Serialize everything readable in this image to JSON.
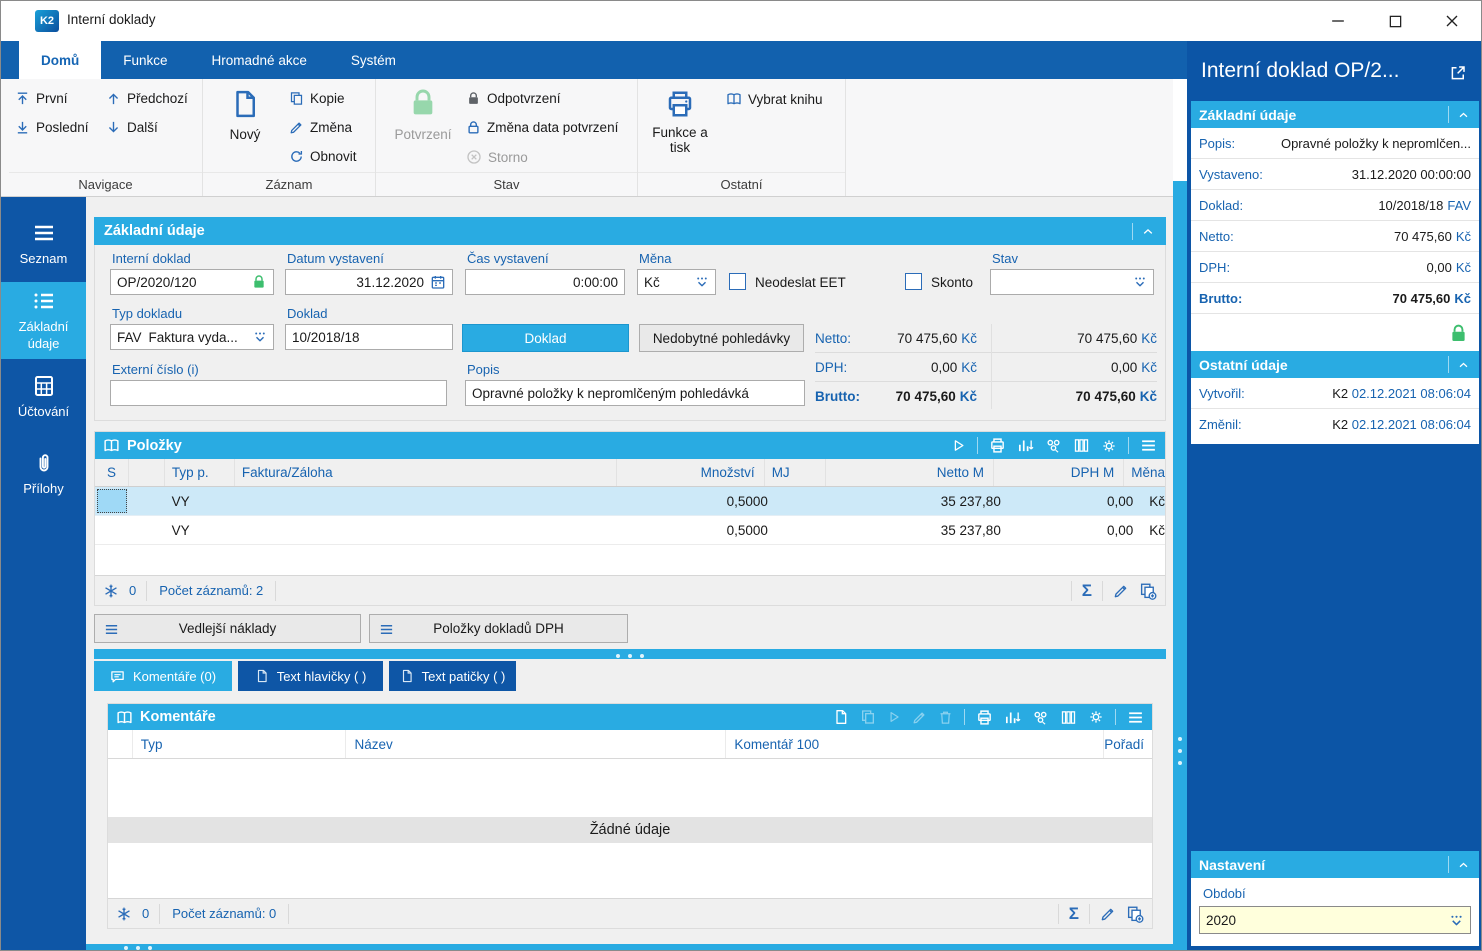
{
  "window": {
    "title": "Interní doklady"
  },
  "icons": {
    "sum_symbol": "Σ"
  },
  "ribbon": {
    "tabs": [
      {
        "label": "Domů"
      },
      {
        "label": "Funkce"
      },
      {
        "label": "Hromadné akce"
      },
      {
        "label": "Systém"
      }
    ],
    "navigace": {
      "label": "Navigace",
      "first": "První",
      "previous": "Předchozí",
      "last": "Poslední",
      "next": "Další"
    },
    "zaznam": {
      "label": "Záznam",
      "new": "Nový",
      "copy": "Kopie",
      "change": "Změna",
      "refresh": "Obnovit"
    },
    "stav": {
      "label": "Stav",
      "confirm": "Potvrzení",
      "unconfirm": "Odpotvrzení",
      "change_date": "Změna data potvrzení",
      "cancel": "Storno"
    },
    "ostatni": {
      "label": "Ostatní",
      "functions_print_line1": "Funkce a",
      "functions_print_line2": "tisk",
      "select_book": "Vybrat knihu"
    }
  },
  "sidebar": {
    "items": [
      {
        "label": "Seznam"
      },
      {
        "label": "Základní údaje"
      },
      {
        "label": "Účtování"
      },
      {
        "label": "Přílohy"
      }
    ]
  },
  "form": {
    "header": "Základní údaje",
    "interni_doklad": {
      "label": "Interní doklad",
      "value": "OP/2020/120"
    },
    "datum": {
      "label": "Datum vystavení",
      "value": "31.12.2020"
    },
    "cas": {
      "label": "Čas vystavení",
      "value": "0:00:00"
    },
    "mena": {
      "label": "Měna",
      "value": "Kč"
    },
    "neodeslat_eet": "Neodeslat EET",
    "skonto": "Skonto",
    "stav": {
      "label": "Stav",
      "value": ""
    },
    "typ_dokladu": {
      "label": "Typ dokladu",
      "code": "FAV",
      "value": "Faktura vyda..."
    },
    "doklad": {
      "label": "Doklad",
      "value": "10/2018/18"
    },
    "doklad_button": "Doklad",
    "nedobytne_button": "Nedobytné pohledávky",
    "externi": {
      "label": "Externí číslo (i)",
      "value": ""
    },
    "popis": {
      "label": "Popis",
      "value": "Opravné položky k nepromlčeným pohledávká"
    },
    "totals": {
      "netto": {
        "label": "Netto:",
        "value": "70 475,60",
        "unit": "Kč",
        "value2": "70 475,60",
        "unit2": "Kč"
      },
      "dph": {
        "label": "DPH:",
        "value": "0,00",
        "unit": "Kč",
        "value2": "0,00",
        "unit2": "Kč"
      },
      "brutto": {
        "label": "Brutto:",
        "value": "70 475,60",
        "unit": "Kč",
        "value2": "70 475,60",
        "unit2": "Kč"
      }
    }
  },
  "polozky": {
    "title": "Položky",
    "columns": {
      "s": "S",
      "typ": "Typ p.",
      "faktura": "Faktura/Záloha",
      "mnozstvi": "Množství",
      "mj": "MJ",
      "netto": "Netto M",
      "dph": "DPH M",
      "mena": "Měna"
    },
    "rows": [
      {
        "typ": "VY",
        "faktura": "",
        "mnozstvi": "0,5000",
        "mj": "",
        "netto": "35 237,80",
        "dph": "0,00",
        "mena": "Kč"
      },
      {
        "typ": "VY",
        "faktura": "",
        "mnozstvi": "0,5000",
        "mj": "",
        "netto": "35 237,80",
        "dph": "0,00",
        "mena": "Kč"
      }
    ],
    "footer": {
      "frozen": "0",
      "count": "Počet záznamů: 2"
    }
  },
  "buttons": {
    "vedlejsi": "Vedlejší náklady",
    "polozky_dph": "Položky dokladů DPH"
  },
  "tabs_bottom": [
    {
      "label": "Komentáře (0)"
    },
    {
      "label": "Text hlavičky ( )"
    },
    {
      "label": "Text patičky ( )"
    }
  ],
  "komentare": {
    "title": "Komentáře",
    "columns": {
      "typ": "Typ",
      "nazev": "Název",
      "komentar": "Komentář 100",
      "poradi": "Pořadí"
    },
    "empty": "Žádné údaje",
    "footer": {
      "frozen": "0",
      "count": "Počet záznamů: 0"
    }
  },
  "right_panel": {
    "title": "Interní doklad OP/2...",
    "zakladni": {
      "header": "Základní údaje",
      "popis": {
        "label": "Popis:",
        "value": "Opravné položky k nepromlčen..."
      },
      "vystaveno": {
        "label": "Vystaveno:",
        "value": "31.12.2020 00:00:00"
      },
      "doklad": {
        "label": "Doklad:",
        "value": "10/2018/18",
        "unit": "FAV"
      },
      "netto": {
        "label": "Netto:",
        "value": "70 475,60",
        "unit": "Kč"
      },
      "dph": {
        "label": "DPH:",
        "value": "0,00",
        "unit": "Kč"
      },
      "brutto": {
        "label": "Brutto:",
        "value": "70 475,60",
        "unit": "Kč"
      }
    },
    "ostatni": {
      "header": "Ostatní údaje",
      "vytvoril": {
        "label": "Vytvořil:",
        "user": "K2",
        "value": "02.12.2021 08:06:04"
      },
      "zmenil": {
        "label": "Změnil:",
        "user": "K2",
        "value": "02.12.2021 08:06:04"
      }
    },
    "nastaveni": {
      "header": "Nastavení",
      "obdobi_label": "Období",
      "obdobi_value": "2020"
    }
  },
  "colors": {
    "accent_cyan": "#29ABE2",
    "dark_blue": "#0E56A6",
    "tab_blue": "#1261AE",
    "link_blue": "#1763B0",
    "green_lock": "#3DBE6E",
    "selected_row": "#CDE9F8",
    "field_yellow": "#FFFFDC"
  }
}
